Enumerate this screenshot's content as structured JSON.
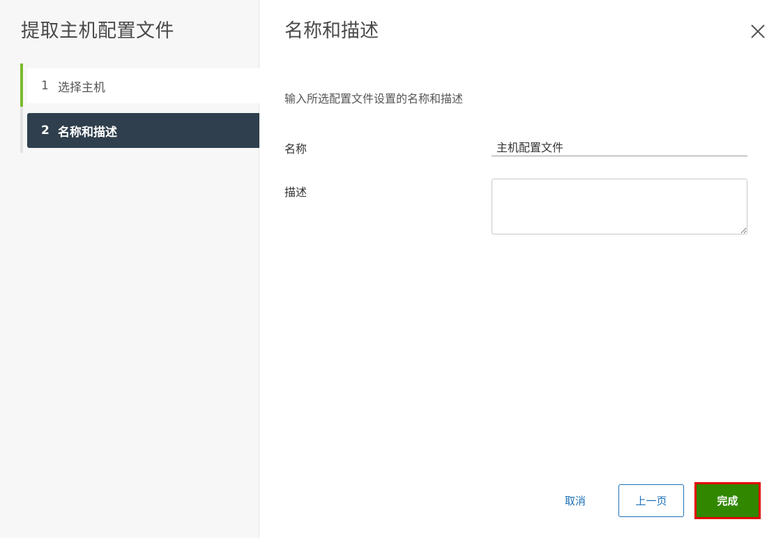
{
  "wizard": {
    "title": "提取主机配置文件",
    "steps": [
      {
        "number": "1",
        "label": "选择主机",
        "state": "completed"
      },
      {
        "number": "2",
        "label": "名称和描述",
        "state": "active"
      }
    ]
  },
  "page": {
    "title": "名称和描述",
    "instruction": "输入所选配置文件设置的名称和描述"
  },
  "form": {
    "name_label": "名称",
    "name_value": "主机配置文件",
    "description_label": "描述",
    "description_value": ""
  },
  "footer": {
    "cancel_label": "取消",
    "back_label": "上一页",
    "finish_label": "完成"
  },
  "icons": {
    "close": "close-icon"
  },
  "colors": {
    "active_step_bg": "#2f3f4d",
    "completed_step_accent": "#7dba2f",
    "primary_button": "#318700",
    "link_blue": "#1d70b7",
    "highlight_border": "#e30000"
  }
}
